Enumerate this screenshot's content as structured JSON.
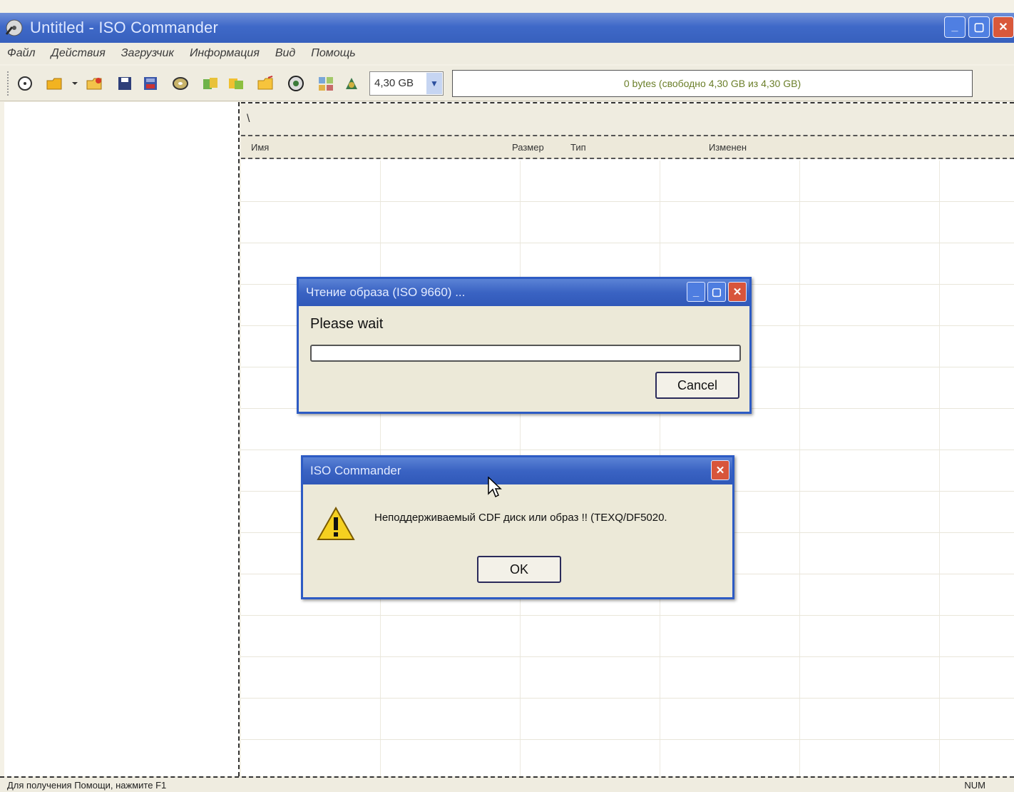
{
  "window": {
    "title": "Untitled - ISO Commander",
    "minimize_icon": "minimize-icon",
    "maximize_icon": "maximize-icon",
    "close_icon": "close-icon"
  },
  "menu": {
    "items": [
      {
        "label": "Файл"
      },
      {
        "label": "Действия"
      },
      {
        "label": "Загрузчик"
      },
      {
        "label": "Информация"
      },
      {
        "label": "Вид"
      },
      {
        "label": "Помощь"
      }
    ]
  },
  "toolbar": {
    "icons": [
      "new-icon",
      "open-icon",
      "open-dropdown-icon",
      "recent-icon",
      "save-icon",
      "save-as-icon",
      "disc-icon",
      "extract-icon",
      "add-icon",
      "folder-icon",
      "burn-icon",
      "properties-icon",
      "settings-icon"
    ],
    "size_select": "4,30 GB",
    "capacity_text": "0 bytes (свободно 4,30 GB из 4,30 GB)"
  },
  "right_pane": {
    "path": "\\",
    "columns": {
      "name": "Имя",
      "size": "Размер",
      "type": "Тип",
      "modified": "Изменен"
    }
  },
  "progress_dialog": {
    "title": "Чтение образа (ISO 9660) ...",
    "label": "Please wait",
    "progress": 0,
    "cancel_label": "Cancel"
  },
  "message_dialog": {
    "title": "ISO Commander",
    "message": "Неподдерживаемый CDF диск или образ !! (TEXQ/DF5020.",
    "ok_label": "OK",
    "icon": "warning-icon"
  },
  "statusbar": {
    "hint": "Для получения Помощи, нажмите F1",
    "num": "NUM"
  }
}
